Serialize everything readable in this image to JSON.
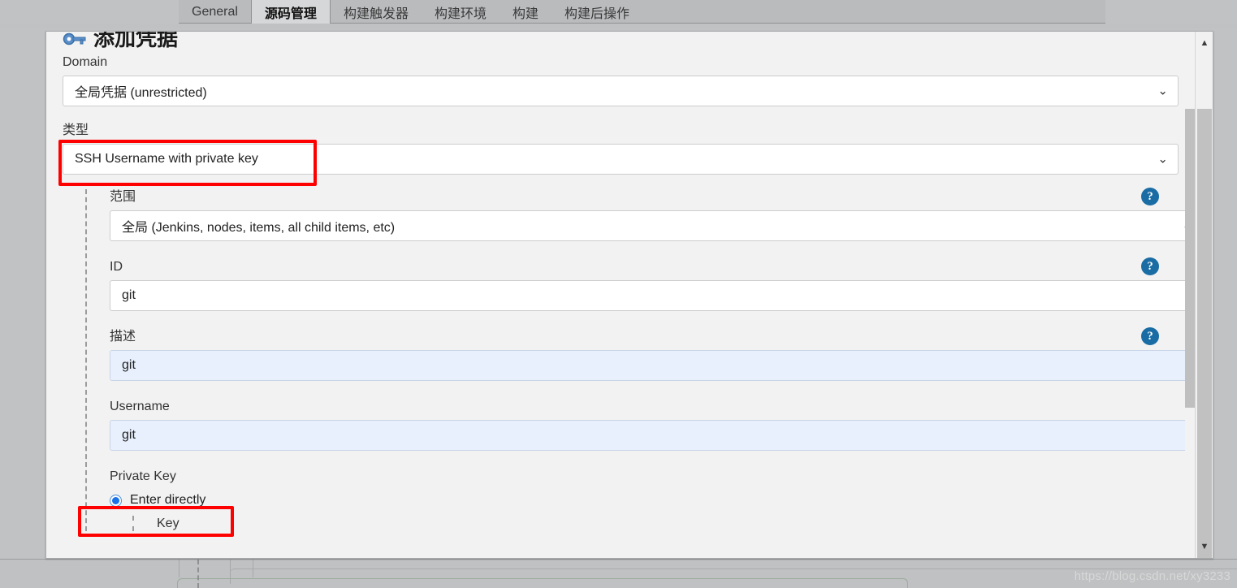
{
  "background": {
    "tabs": [
      {
        "label": "General",
        "active": false
      },
      {
        "label": "源码管理",
        "active": true
      },
      {
        "label": "构建触发器",
        "active": false
      },
      {
        "label": "构建环境",
        "active": false
      },
      {
        "label": "构建",
        "active": false
      },
      {
        "label": "构建后操作",
        "active": false
      }
    ]
  },
  "dialog": {
    "title": "添加凭据",
    "icon": "key-icon",
    "fields": {
      "domain": {
        "label": "Domain",
        "value": "全局凭据 (unrestricted)",
        "chevron": "⌄"
      },
      "type": {
        "label": "类型",
        "value": "SSH Username with private key",
        "chevron": "⌄"
      },
      "scope": {
        "label": "范围",
        "value": "全局 (Jenkins, nodes, items, all child items, etc)",
        "chevron": "⌄",
        "help": "?"
      },
      "id": {
        "label": "ID",
        "value": "git",
        "help": "?"
      },
      "description": {
        "label": "描述",
        "value": "git",
        "help": "?"
      },
      "username": {
        "label": "Username",
        "value": "git"
      },
      "private_key": {
        "label": "Private Key",
        "radio_label": "Enter directly",
        "radio_selected": true,
        "key_label": "Key"
      }
    }
  },
  "scrollbars": {
    "outer_up_arrow": "▲",
    "outer_down_arrow": "▼"
  },
  "annotations": {
    "highlight_color": "#ff0000",
    "boxes": [
      "type-field",
      "enter-directly-radio"
    ]
  },
  "watermark": "https://blog.csdn.net/xy3233",
  "colors": {
    "accent_blue": "#1a73e8",
    "help_blue": "#1a6ca4",
    "autofill_bg": "#e8f0fe",
    "dialog_bg": "#f2f2f2",
    "page_bg": "#c0c2c4"
  }
}
